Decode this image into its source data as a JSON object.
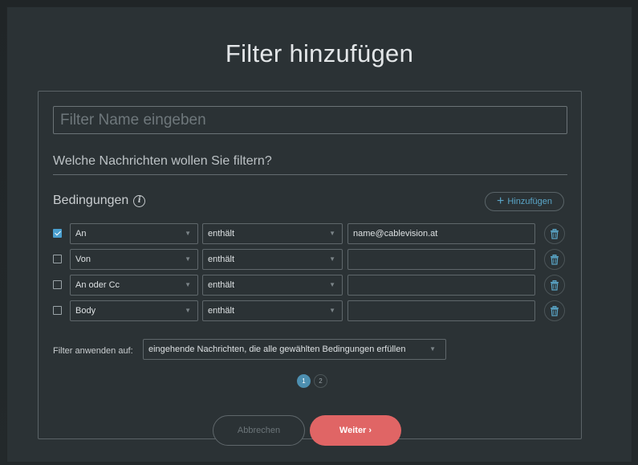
{
  "dialog": {
    "title": "Filter hinzufügen",
    "name_placeholder": "Filter Name eingeben",
    "question": "Welche Nachrichten wollen Sie filtern?",
    "conditions_label": "Bedingungen",
    "add_label": "Hinzufügen"
  },
  "rows": [
    {
      "checked": true,
      "field": "An",
      "operator": "enthält",
      "value": "name@cablevision.at"
    },
    {
      "checked": false,
      "field": "Von",
      "operator": "enthält",
      "value": ""
    },
    {
      "checked": false,
      "field": "An oder Cc",
      "operator": "enthält",
      "value": ""
    },
    {
      "checked": false,
      "field": "Body",
      "operator": "enthält",
      "value": ""
    }
  ],
  "apply": {
    "label": "Filter anwenden auf:",
    "selected": "eingehende Nachrichten, die alle gewählten Bedingungen erfüllen"
  },
  "pagination": {
    "pages": [
      "1",
      "2"
    ],
    "current": "1"
  },
  "buttons": {
    "cancel": "Abbrechen",
    "next": "Weiter ›"
  },
  "colors": {
    "accent_blue": "#5aa6c8",
    "next_button": "#e06565",
    "background": "#2b3235"
  },
  "icons": {
    "info": "info-icon",
    "delete": "trash-icon",
    "dropdown": "chevron-down-icon",
    "add": "plus-icon"
  }
}
